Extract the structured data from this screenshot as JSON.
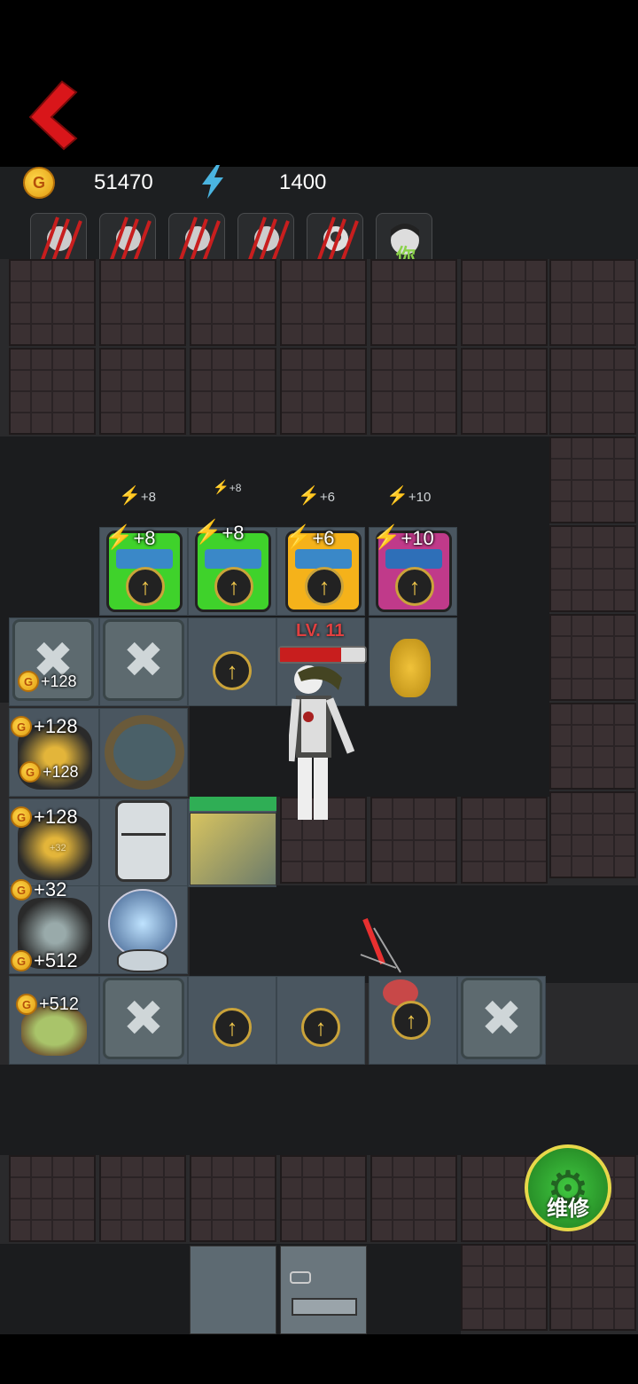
{
  "hud": {
    "gold": "51470",
    "energy": "1400",
    "coin_symbol": "G",
    "portraits": [
      {
        "name": "clawed-portrait-1"
      },
      {
        "name": "clawed-portrait-2"
      },
      {
        "name": "clawed-portrait-3"
      },
      {
        "name": "clawed-portrait-4"
      },
      {
        "name": "clawed-portrait-5"
      },
      {
        "name": "player-portrait",
        "label": "你"
      }
    ]
  },
  "energy_labels": [
    "+8",
    "+8",
    "+6",
    "+10"
  ],
  "machines": [
    {
      "bonus": "+8",
      "color": "#3fd22b"
    },
    {
      "bonus": "+8",
      "color": "#3fd22b"
    },
    {
      "bonus": "+6",
      "color": "#f5b21a"
    },
    {
      "bonus": "+10",
      "color": "#c03a8a"
    }
  ],
  "enemy": {
    "level": "LV. 11",
    "hp_fraction": 0.72
  },
  "gold_labels": {
    "wrench_row1": "+128",
    "side1_a": "+128",
    "side1_b": "+128",
    "side2_a": "+128",
    "side2_b": "+32",
    "side3_a": "+32",
    "side3_b": "+512",
    "side4_a": "+512"
  },
  "door_hp_fraction": 1.0,
  "repair_button": {
    "label": "维修",
    "color": "#2fae33"
  }
}
